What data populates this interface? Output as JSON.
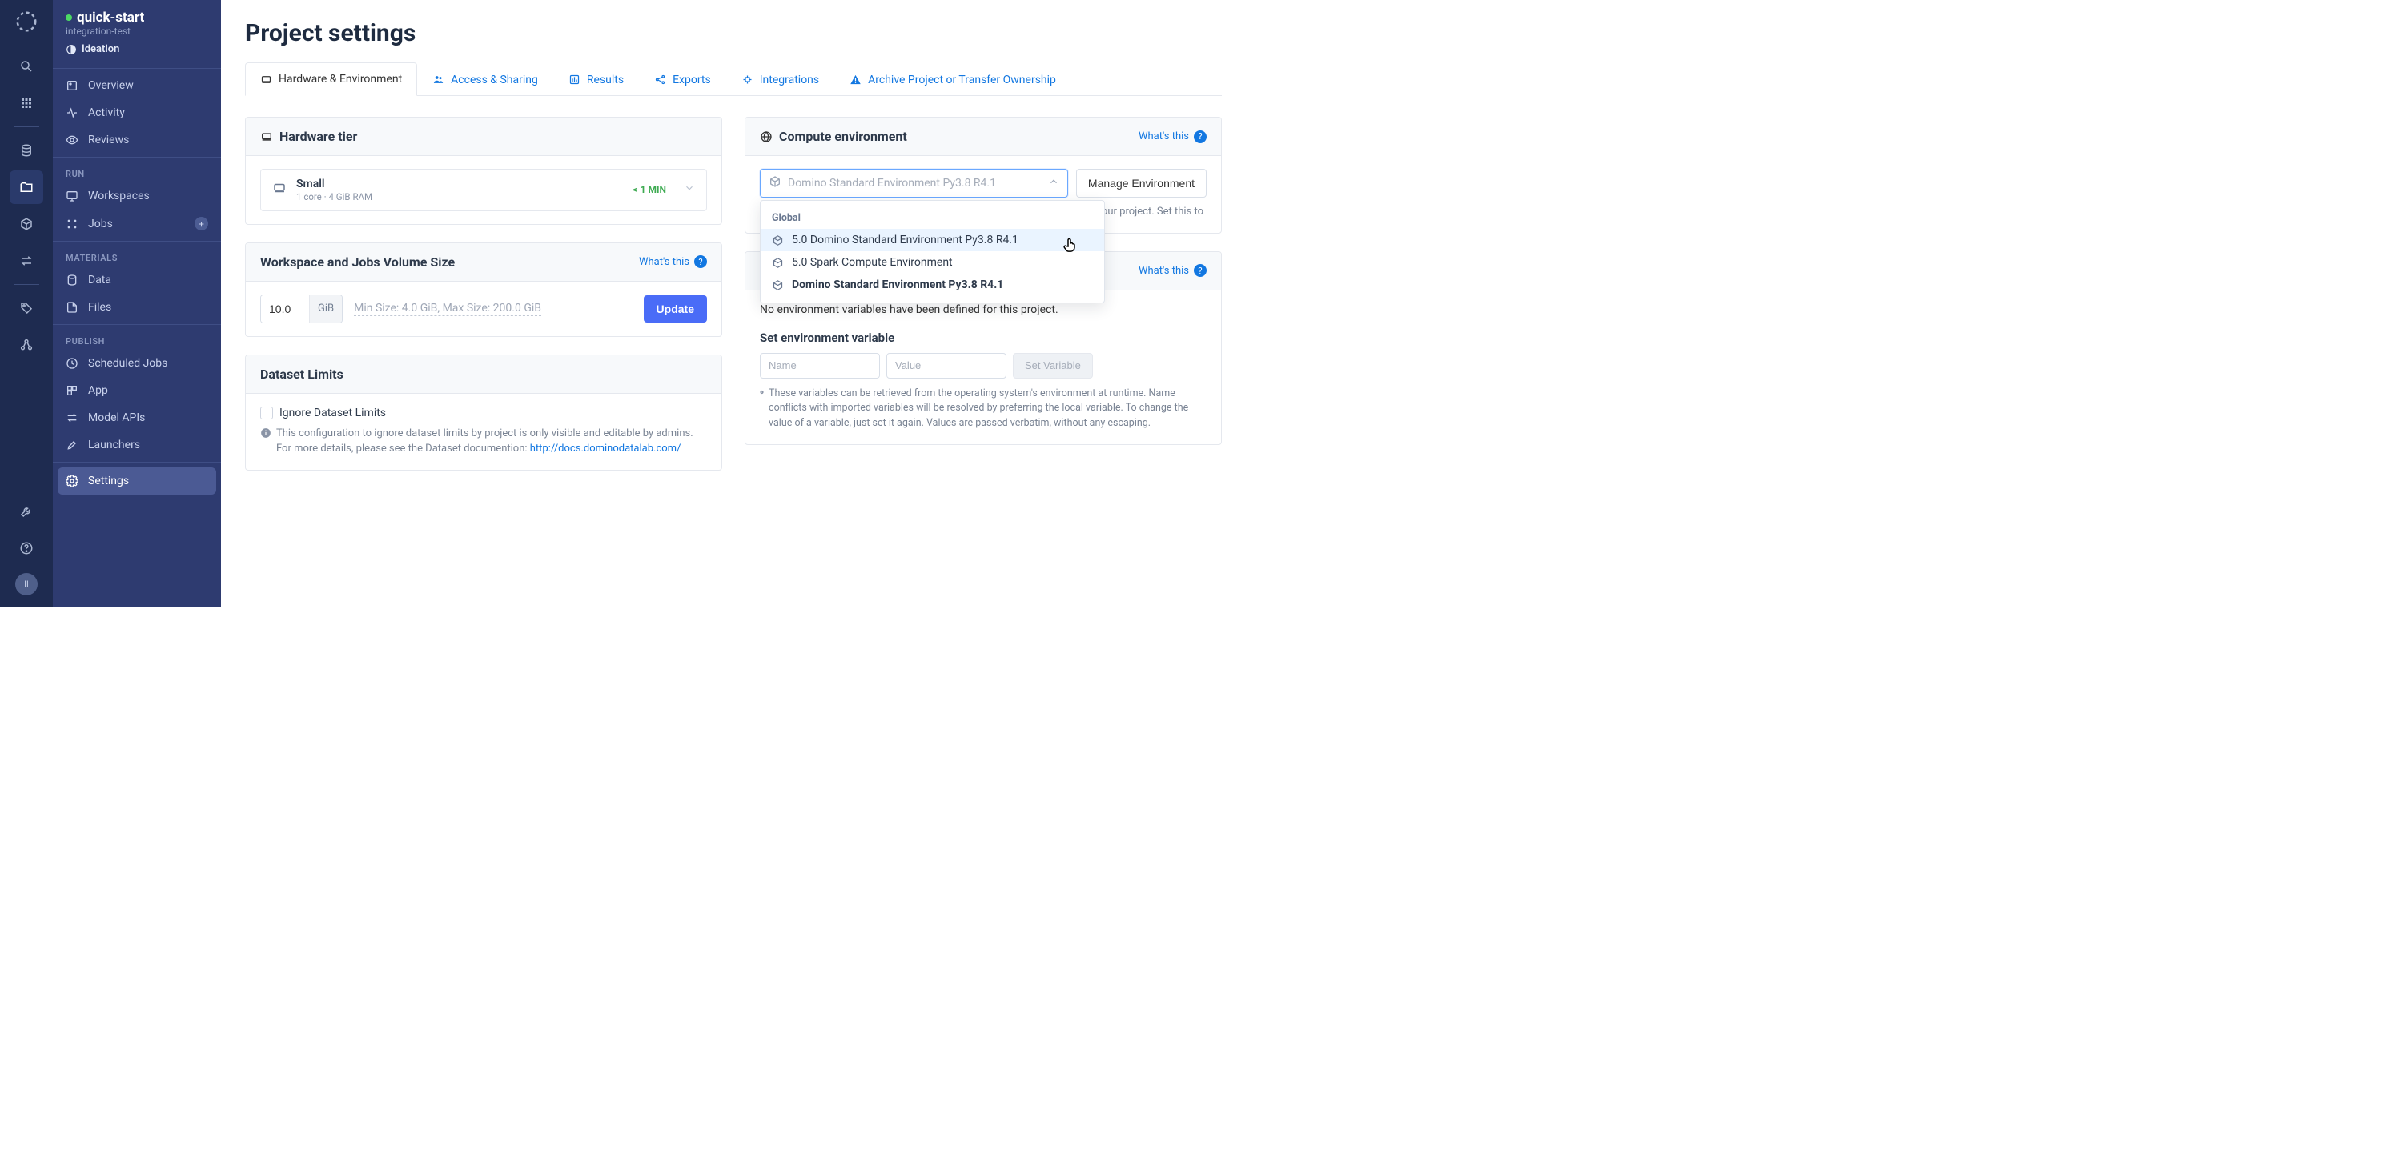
{
  "project": {
    "name": "quick-start",
    "owner": "integration-test",
    "stage": "Ideation"
  },
  "sidebar": {
    "items": {
      "overview": "Overview",
      "activity": "Activity",
      "reviews": "Reviews",
      "workspaces": "Workspaces",
      "jobs": "Jobs",
      "data": "Data",
      "files": "Files",
      "sched": "Scheduled Jobs",
      "app": "App",
      "modelapis": "Model APIs",
      "launchers": "Launchers",
      "settings": "Settings"
    },
    "sections": {
      "run": "RUN",
      "materials": "MATERIALS",
      "publish": "PUBLISH"
    }
  },
  "page": {
    "title": "Project settings"
  },
  "tabs": {
    "hw": "Hardware & Environment",
    "access": "Access & Sharing",
    "results": "Results",
    "exports": "Exports",
    "integrations": "Integrations",
    "archive": "Archive Project or Transfer Ownership"
  },
  "whats_this": "What's this",
  "hw_card": {
    "title": "Hardware tier",
    "tier_name": "Small",
    "tier_spec": "1 core · 4 GiB RAM",
    "duration": "< 1 MIN"
  },
  "vol_card": {
    "title": "Workspace and Jobs Volume Size",
    "value": "10.0",
    "unit": "GiB",
    "hint": "Min Size: 4.0 GiB, Max Size: 200.0 GiB",
    "update": "Update"
  },
  "ds_card": {
    "title": "Dataset Limits",
    "checkbox": "Ignore Dataset Limits",
    "info": "This configuration to ignore dataset limits by project is only visible and editable by admins. For more details, please see the Dataset documention: ",
    "link": "http://docs.dominodatalab.com/"
  },
  "env_card": {
    "title": "Compute environment",
    "selected_placeholder": "Domino Standard Environment Py3.8 R4.1",
    "manage": "Manage Environment",
    "desc_tail": "your project. Set this to",
    "dd_section": "Global",
    "opt1": "5.0 Domino Standard Environment Py3.8 R4.1",
    "opt2": "5.0 Spark Compute Environment",
    "opt3": "Domino Standard Environment Py3.8 R4.1"
  },
  "ev_card": {
    "empty": "No environment variables have been defined for this project.",
    "heading": "Set environment variable",
    "name_ph": "Name",
    "value_ph": "Value",
    "button": "Set Variable",
    "footnote": "These variables can be retrieved from the operating system's environment at runtime. Name conflicts with imported variables will be resolved by preferring the local variable. To change the value of a variable, just set it again. Values are passed verbatim, without any escaping."
  },
  "avatar": "II"
}
